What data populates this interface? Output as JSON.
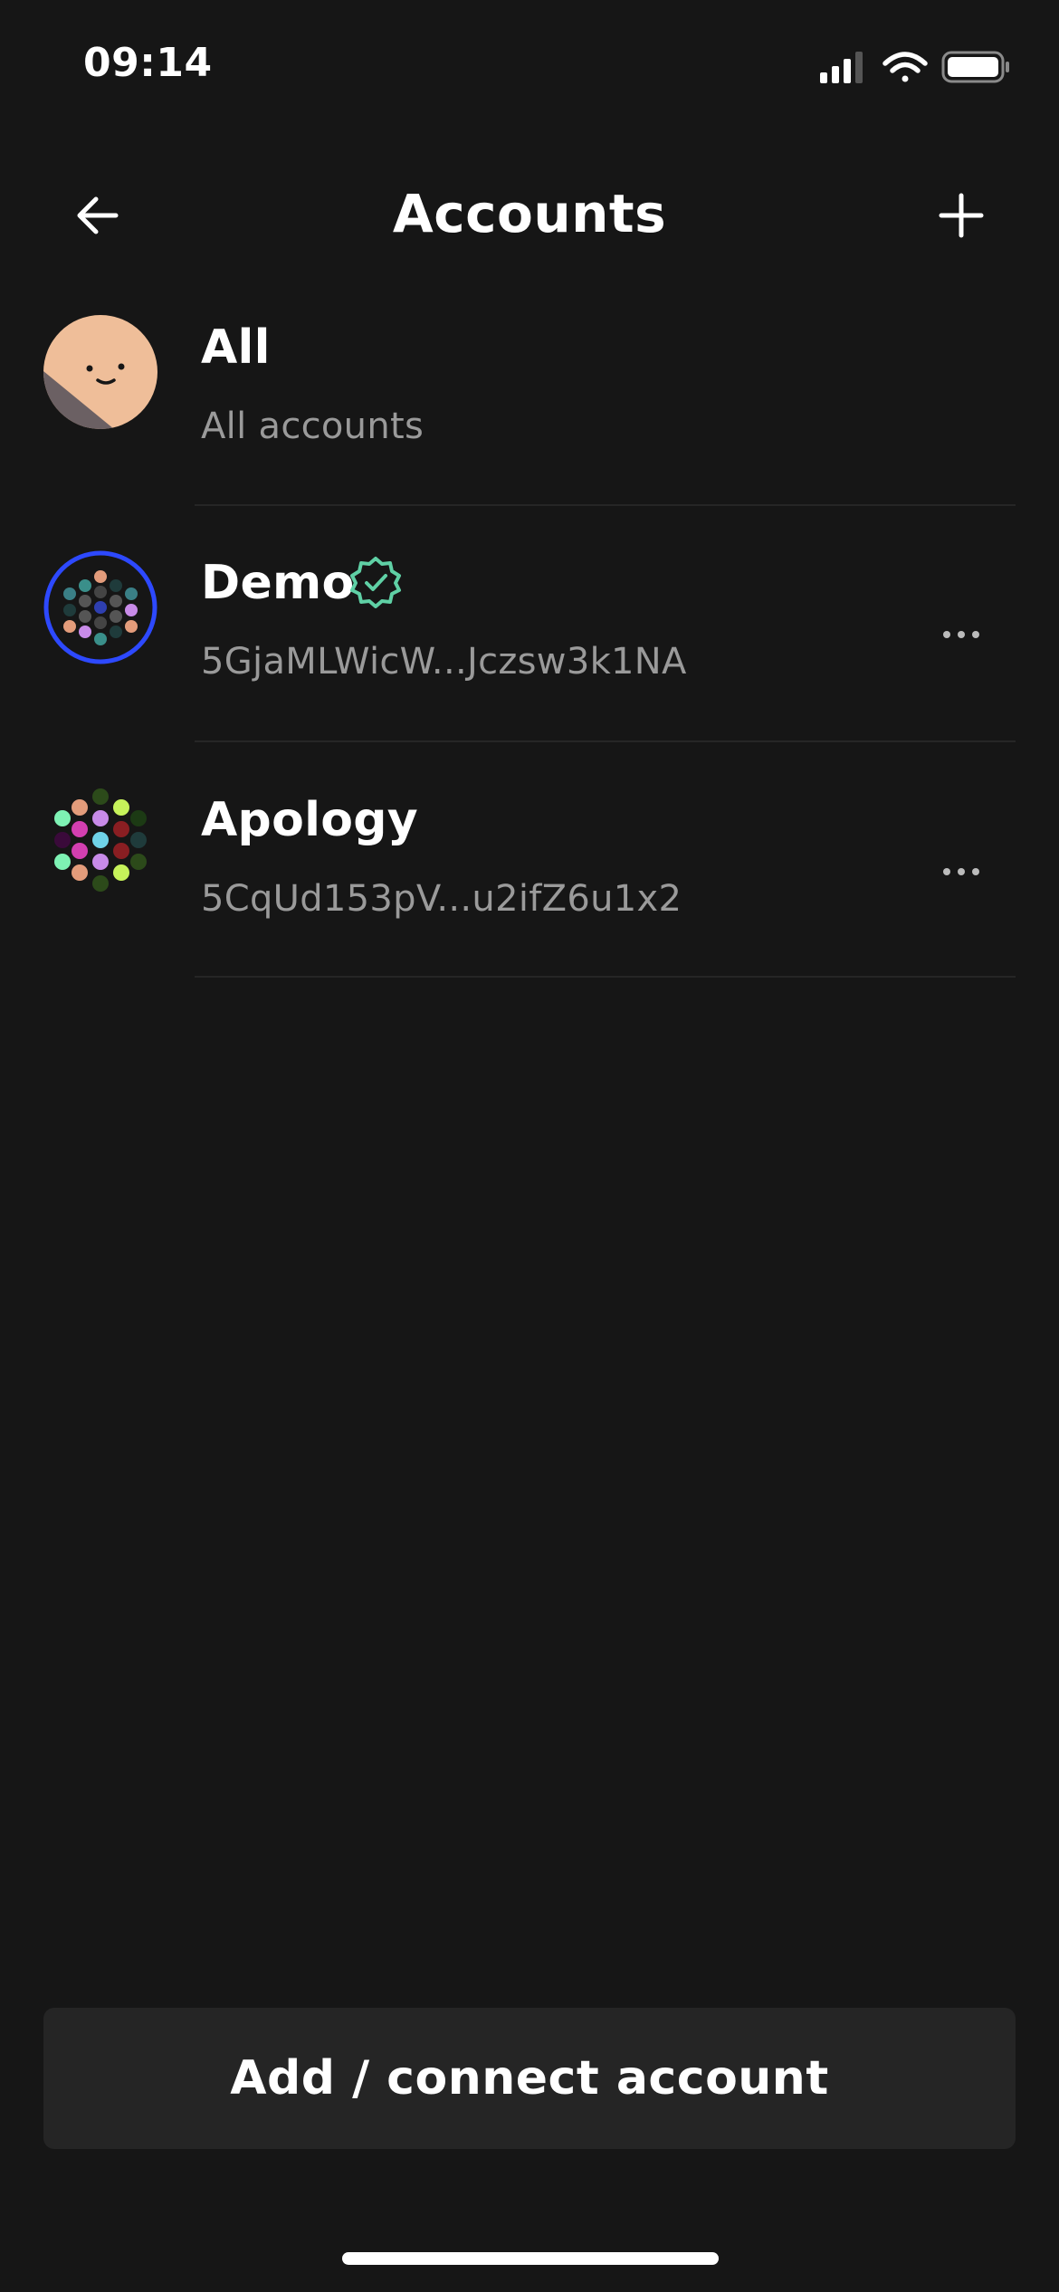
{
  "status_bar": {
    "time": "09:14"
  },
  "header": {
    "title": "Accounts",
    "back_icon": "arrow-left-icon",
    "add_icon": "plus-icon"
  },
  "accounts": [
    {
      "name": "All",
      "subtitle": "All accounts",
      "avatar": "smiley-face-avatar"
    },
    {
      "name": "Demo",
      "subtitle": "5GjaMLWicW...Jczsw3k1NA",
      "avatar": "identicon-avatar",
      "verified": true,
      "selected": true
    },
    {
      "name": "Apology",
      "subtitle": "5CqUd153pV...u2ifZ6u1x2",
      "avatar": "identicon-avatar"
    }
  ],
  "footer": {
    "button_label": "Add / connect account"
  },
  "colors": {
    "background": "#161616",
    "accent_ring": "#2d49ff",
    "verified": "#5fd0a5",
    "secondary_text": "#9a9a9a",
    "button_bg": "#252525"
  }
}
